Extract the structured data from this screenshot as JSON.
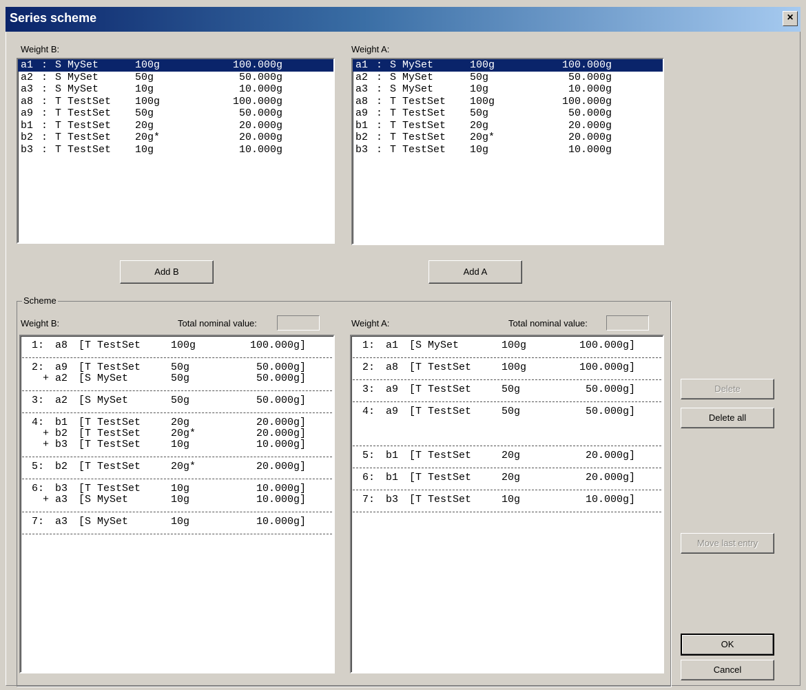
{
  "window": {
    "title": "Series scheme",
    "close_label": "×"
  },
  "weight_b": {
    "label": "Weight B:",
    "items": [
      {
        "id": "a1",
        "sep": ":",
        "set": "S MySet",
        "nominal": "100g",
        "value": "100.000g",
        "selected": true
      },
      {
        "id": "a2",
        "sep": ":",
        "set": "S MySet",
        "nominal": "50g",
        "value": "50.000g"
      },
      {
        "id": "a3",
        "sep": ":",
        "set": "S MySet",
        "nominal": "10g",
        "value": "10.000g"
      },
      {
        "id": "a8",
        "sep": ":",
        "set": "T TestSet",
        "nominal": "100g",
        "value": "100.000g"
      },
      {
        "id": "a9",
        "sep": ":",
        "set": "T TestSet",
        "nominal": "50g",
        "value": "50.000g"
      },
      {
        "id": "b1",
        "sep": ":",
        "set": "T TestSet",
        "nominal": "20g",
        "value": "20.000g"
      },
      {
        "id": "b2",
        "sep": ":",
        "set": "T TestSet",
        "nominal": "20g*",
        "value": "20.000g"
      },
      {
        "id": "b3",
        "sep": ":",
        "set": "T TestSet",
        "nominal": "10g",
        "value": "10.000g"
      }
    ]
  },
  "weight_a": {
    "label": "Weight A:",
    "items": [
      {
        "id": "a1",
        "sep": ":",
        "set": "S MySet",
        "nominal": "100g",
        "value": "100.000g",
        "selected": true
      },
      {
        "id": "a2",
        "sep": ":",
        "set": "S MySet",
        "nominal": "50g",
        "value": "50.000g"
      },
      {
        "id": "a3",
        "sep": ":",
        "set": "S MySet",
        "nominal": "10g",
        "value": "10.000g"
      },
      {
        "id": "a8",
        "sep": ":",
        "set": "T TestSet",
        "nominal": "100g",
        "value": "100.000g"
      },
      {
        "id": "a9",
        "sep": ":",
        "set": "T TestSet",
        "nominal": "50g",
        "value": "50.000g"
      },
      {
        "id": "b1",
        "sep": ":",
        "set": "T TestSet",
        "nominal": "20g",
        "value": "20.000g"
      },
      {
        "id": "b2",
        "sep": ":",
        "set": "T TestSet",
        "nominal": "20g*",
        "value": "20.000g"
      },
      {
        "id": "b3",
        "sep": ":",
        "set": "T TestSet",
        "nominal": "10g",
        "value": "10.000g"
      }
    ]
  },
  "buttons": {
    "add_b": "Add B",
    "add_a": "Add A",
    "delete": "Delete",
    "delete_all": "Delete all",
    "move_last": "Move last entry",
    "ok": "OK",
    "cancel": "Cancel"
  },
  "scheme": {
    "label": "Scheme",
    "total_label": "Total nominal value:",
    "total_b": "",
    "total_a": "",
    "weight_b_label": "Weight B:",
    "weight_a_label": "Weight A:",
    "b_groups": [
      {
        "rows": [
          {
            "prefix": "1:",
            "id": "a8",
            "set": "[T TestSet",
            "nominal": "100g",
            "value": "100.000g]"
          }
        ]
      },
      {
        "rows": [
          {
            "prefix": "2:",
            "id": "a9",
            "set": "[T TestSet",
            "nominal": "50g",
            "value": "50.000g]"
          },
          {
            "prefix": "+",
            "id": "a2",
            "set": "[S MySet",
            "nominal": "50g",
            "value": "50.000g]"
          }
        ]
      },
      {
        "rows": [
          {
            "prefix": "3:",
            "id": "a2",
            "set": "[S MySet",
            "nominal": "50g",
            "value": "50.000g]"
          }
        ]
      },
      {
        "rows": [
          {
            "prefix": "4:",
            "id": "b1",
            "set": "[T TestSet",
            "nominal": "20g",
            "value": "20.000g]"
          },
          {
            "prefix": "+",
            "id": "b2",
            "set": "[T TestSet",
            "nominal": "20g*",
            "value": "20.000g]"
          },
          {
            "prefix": "+",
            "id": "b3",
            "set": "[T TestSet",
            "nominal": "10g",
            "value": "10.000g]"
          }
        ]
      },
      {
        "rows": [
          {
            "prefix": "5:",
            "id": "b2",
            "set": "[T TestSet",
            "nominal": "20g*",
            "value": "20.000g]"
          }
        ]
      },
      {
        "rows": [
          {
            "prefix": "6:",
            "id": "b3",
            "set": "[T TestSet",
            "nominal": "10g",
            "value": "10.000g]"
          },
          {
            "prefix": "+",
            "id": "a3",
            "set": "[S MySet",
            "nominal": "10g",
            "value": "10.000g]"
          }
        ]
      },
      {
        "rows": [
          {
            "prefix": "7:",
            "id": "a3",
            "set": "[S MySet",
            "nominal": "10g",
            "value": "10.000g]"
          }
        ]
      }
    ],
    "a_groups": [
      {
        "rows": [
          {
            "prefix": "1:",
            "id": "a1",
            "set": "[S MySet",
            "nominal": "100g",
            "value": "100.000g]"
          }
        ]
      },
      {
        "rows": [
          {
            "prefix": "2:",
            "id": "a8",
            "set": "[T TestSet",
            "nominal": "100g",
            "value": "100.000g]"
          }
        ]
      },
      {
        "rows": [
          {
            "prefix": "3:",
            "id": "a9",
            "set": "[T TestSet",
            "nominal": "50g",
            "value": "50.000g]"
          }
        ]
      },
      {
        "rows": [
          {
            "prefix": "4:",
            "id": "a9",
            "set": "[T TestSet",
            "nominal": "50g",
            "value": "50.000g]"
          }
        ]
      },
      {
        "rows": [
          {
            "prefix": "5:",
            "id": "b1",
            "set": "[T TestSet",
            "nominal": "20g",
            "value": "20.000g]"
          }
        ]
      },
      {
        "rows": [
          {
            "prefix": "6:",
            "id": "b1",
            "set": "[T TestSet",
            "nominal": "20g",
            "value": "20.000g]"
          }
        ]
      },
      {
        "rows": [
          {
            "prefix": "7:",
            "id": "b3",
            "set": "[T TestSet",
            "nominal": "10g",
            "value": "10.000g]"
          }
        ]
      }
    ]
  }
}
